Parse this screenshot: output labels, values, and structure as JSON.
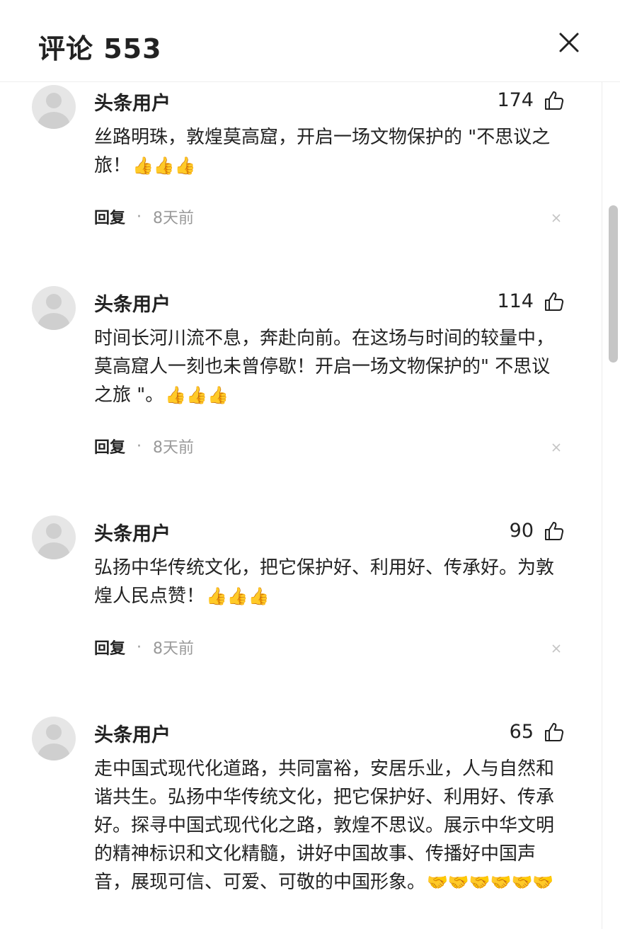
{
  "header": {
    "title": "评论 553",
    "close_icon": "close-icon"
  },
  "comments": [
    {
      "username": "头条用户",
      "likes": "174",
      "text": "丝路明珠，敦煌莫高窟，开启一场文物保护的 \"不思议之旅！",
      "emoji": "👍👍👍",
      "reply": "回复",
      "dot": "·",
      "time": "8天前"
    },
    {
      "username": "头条用户",
      "likes": "114",
      "text": "时间长河川流不息，奔赴向前。在这场与时间的较量中，莫高窟人一刻也未曾停歇！开启一场文物保护的\" 不思议之旅 \"。",
      "emoji": "👍👍👍",
      "reply": "回复",
      "dot": "·",
      "time": "8天前"
    },
    {
      "username": "头条用户",
      "likes": "90",
      "text": "弘扬中华传统文化，把它保护好、利用好、传承好。为敦煌人民点赞！",
      "emoji": "👍👍👍",
      "reply": "回复",
      "dot": "·",
      "time": "8天前"
    },
    {
      "username": "头条用户",
      "likes": "65",
      "text": "走中国式现代化道路，共同富裕，安居乐业，人与自然和谐共生。弘扬中华传统文化，把它保护好、利用好、传承好。探寻中国式现代化之路，敦煌不思议。展示中华文明的精神标识和文化精髓，讲好中国故事、传播好中国声音，展现可信、可爱、可敬的中国形象。",
      "emoji": "🤝🤝🤝🤝🤝🤝",
      "reply": "",
      "dot": "",
      "time": ""
    }
  ]
}
